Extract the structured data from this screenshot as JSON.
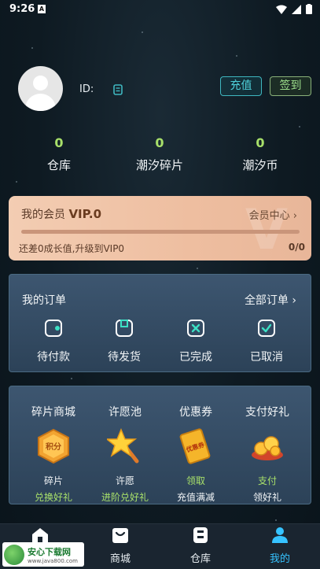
{
  "status": {
    "time": "9:26",
    "app_letter": "A"
  },
  "profile": {
    "id_label": "ID:",
    "recharge": "充值",
    "sign_in": "签到"
  },
  "stats": [
    {
      "value": "0",
      "label": "仓库"
    },
    {
      "value": "0",
      "label": "潮汐碎片"
    },
    {
      "value": "0",
      "label": "潮汐币"
    }
  ],
  "vip": {
    "title": "我的会员",
    "level": "VIP.0",
    "center": "会员中心",
    "chevron": "›",
    "hint": "还差0成长值,升级到VIP0",
    "progress_text": "0/0",
    "progress": 0,
    "watermark": "V"
  },
  "orders": {
    "title": "我的订单",
    "all": "全部订单",
    "chevron": "›",
    "items": [
      {
        "label": "待付款",
        "icon": "wallet-icon"
      },
      {
        "label": "待发货",
        "icon": "box-icon"
      },
      {
        "label": "已完成",
        "icon": "done-icon"
      },
      {
        "label": "已取消",
        "icon": "check-icon"
      }
    ]
  },
  "features": [
    {
      "title": "碎片商城",
      "line1": "碎片",
      "line2": "兑换好礼",
      "icon": "fragment-badge-icon",
      "badge": "积分"
    },
    {
      "title": "许愿池",
      "line1": "许愿",
      "line2": "进阶兑好礼",
      "icon": "star-wand-icon"
    },
    {
      "title": "优惠券",
      "line1": "领取",
      "line2": "充值满减",
      "icon": "coupon-icon",
      "badge": "优惠券"
    },
    {
      "title": "支付好礼",
      "line1": "支付",
      "line2": "领好礼",
      "icon": "coins-icon"
    }
  ],
  "nav": [
    {
      "label": "首页",
      "icon": "home-icon"
    },
    {
      "label": "商城",
      "icon": "shop-icon"
    },
    {
      "label": "仓库",
      "icon": "warehouse-icon"
    },
    {
      "label": "我的",
      "icon": "user-icon",
      "active": true
    }
  ],
  "logo": {
    "title": "安心下载网",
    "url": "www.java800.com"
  },
  "colors": {
    "accent_green": "#a8e06a",
    "accent_cyan": "#36c3ff",
    "vip_bg": "#f3cdb3"
  }
}
